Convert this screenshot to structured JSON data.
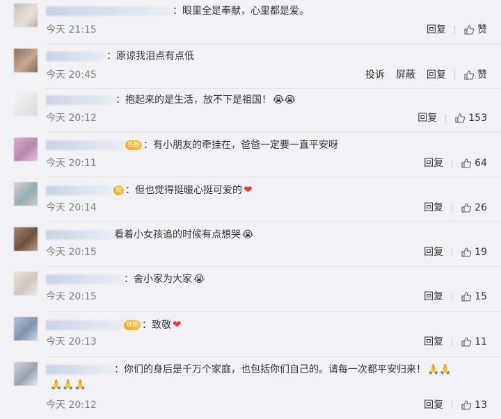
{
  "labels": {
    "reply": "回复",
    "report": "投诉",
    "block": "屏蔽",
    "like_empty": "赞"
  },
  "comments": [
    {
      "text": "：眼里全是奉献，心里都是爱。",
      "time": "今天 21:15",
      "likes": "赞",
      "report": false
    },
    {
      "text": "：原谅我泪点有点低",
      "time": "今天 20:45",
      "likes": "赞",
      "report": true
    },
    {
      "text": "：抱起来的是生活，放不下是祖国！",
      "emoji": "😭😭",
      "time": "今天 20:12",
      "likes": "153",
      "report": false
    },
    {
      "badge": "铁粉",
      "text": "：有小朋友的牵挂在，爸爸一定要一直平安呀",
      "time": "今天 20:11",
      "likes": "64",
      "report": false
    },
    {
      "badge": "粉",
      "text": "：但也觉得挺暖心挺可爱的",
      "emoji": "❤",
      "time": "今天 20:14",
      "likes": "26",
      "report": false
    },
    {
      "text": "看着小女孩追的时候有点想哭",
      "emoji": "😭",
      "time": "今天 20:15",
      "likes": "19",
      "report": false
    },
    {
      "text": "：舍小家为大家",
      "emoji": "😭",
      "time": "今天 20:15",
      "likes": "15",
      "report": false
    },
    {
      "badge": "铁粉",
      "text": "：致敬",
      "emoji": "❤",
      "time": "今天 20:13",
      "likes": "11",
      "report": false
    },
    {
      "text": "：你们的身后是千万个家庭，也包括你们自己的。请每一次都平安归来！",
      "emoji": "🙏🙏",
      "cont": "🙏🙏🙏",
      "time": "今天 20:12",
      "likes": "13",
      "report": false
    }
  ]
}
